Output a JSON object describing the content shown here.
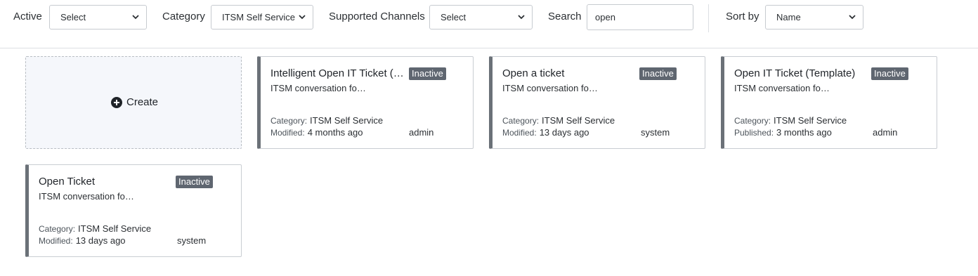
{
  "filters": {
    "active_label": "Active",
    "active_value": "Select",
    "category_label": "Category",
    "category_value": "ITSM Self Service",
    "channels_label": "Supported Channels",
    "channels_value": "Select",
    "search_label": "Search",
    "search_value": "open",
    "sort_label": "Sort by",
    "sort_value": "Name"
  },
  "create": {
    "label": "Create"
  },
  "cards": [
    {
      "title": "Intelligent Open IT Ticket (…",
      "status": "Inactive",
      "description": "ITSM conversation fo…",
      "category_key": "Category:",
      "category": "ITSM Self Service",
      "date_key": "Modified:",
      "date": "4 months ago",
      "owner": "admin"
    },
    {
      "title": "Open a ticket",
      "status": "Inactive",
      "description": "ITSM conversation fo…",
      "category_key": "Category:",
      "category": "ITSM Self Service",
      "date_key": "Modified:",
      "date": "13 days ago",
      "owner": "system"
    },
    {
      "title": "Open IT Ticket (Template)",
      "status": "Inactive",
      "description": "ITSM conversation fo…",
      "category_key": "Category:",
      "category": "ITSM Self Service",
      "date_key": "Published:",
      "date": "3 months ago",
      "owner": "admin"
    },
    {
      "title": "Open Ticket",
      "status": "Inactive",
      "description": "ITSM conversation fo…",
      "category_key": "Category:",
      "category": "ITSM Self Service",
      "date_key": "Modified:",
      "date": "13 days ago",
      "owner": "system"
    }
  ]
}
